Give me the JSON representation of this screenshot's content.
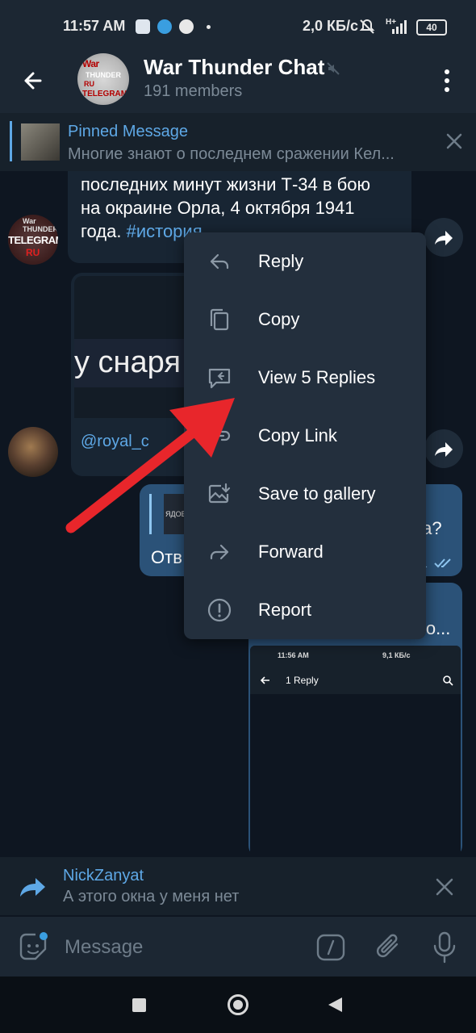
{
  "status_bar": {
    "time": "11:57 AM",
    "network_speed": "2,0 КБ/с",
    "battery": "40",
    "network_type": "H+"
  },
  "header": {
    "title": "War Thunder Chat",
    "members": "191 members",
    "avatar_text": [
      "War",
      "THUNDER",
      "RU",
      "TELEGRAM"
    ]
  },
  "pinned": {
    "title": "Pinned Message",
    "text": "Многие знают о последнем сражении Кел..."
  },
  "messages": {
    "msg1": {
      "line1": "последних минут жизни Т-34 в бою",
      "line2": "на окраине Орла, 4 октября 1941",
      "line3_prefix": "года. ",
      "hashtag": "#история",
      "avatar_text": [
        "War THUNDER",
        "TELEGRAM",
        "RU"
      ]
    },
    "msg2": {
      "image_text": "у снаря",
      "link": "@royal_c"
    },
    "msg3": {
      "quote_thumb_text": "ЯДОВ",
      "text_left": "Отв",
      "text_right": "ка?",
      "time_fragment": "1"
    },
    "msg4": {
      "text_fragment": "то...",
      "screenshot": {
        "time": "11:56 AM",
        "network_speed": "9,1 КБ/с",
        "title": "1 Reply"
      }
    }
  },
  "context_menu": {
    "items": [
      {
        "label": "Reply",
        "icon": "reply-icon"
      },
      {
        "label": "Copy",
        "icon": "copy-icon"
      },
      {
        "label": "View 5 Replies",
        "icon": "view-replies-icon"
      },
      {
        "label": "Copy Link",
        "icon": "link-icon"
      },
      {
        "label": "Save to gallery",
        "icon": "save-gallery-icon"
      },
      {
        "label": "Forward",
        "icon": "forward-icon"
      },
      {
        "label": "Report",
        "icon": "report-icon"
      }
    ]
  },
  "reply_bar": {
    "name": "NickZanyat",
    "text": "А этого окна у меня нет"
  },
  "input": {
    "placeholder": "Message"
  },
  "colors": {
    "background": "#0e1621",
    "header": "#1c2733",
    "accent": "#5ea8e6",
    "outgoing_bubble": "#2b5278",
    "incoming_bubble": "#182533",
    "menu": "#232f3d",
    "arrow": "#e8262b"
  }
}
